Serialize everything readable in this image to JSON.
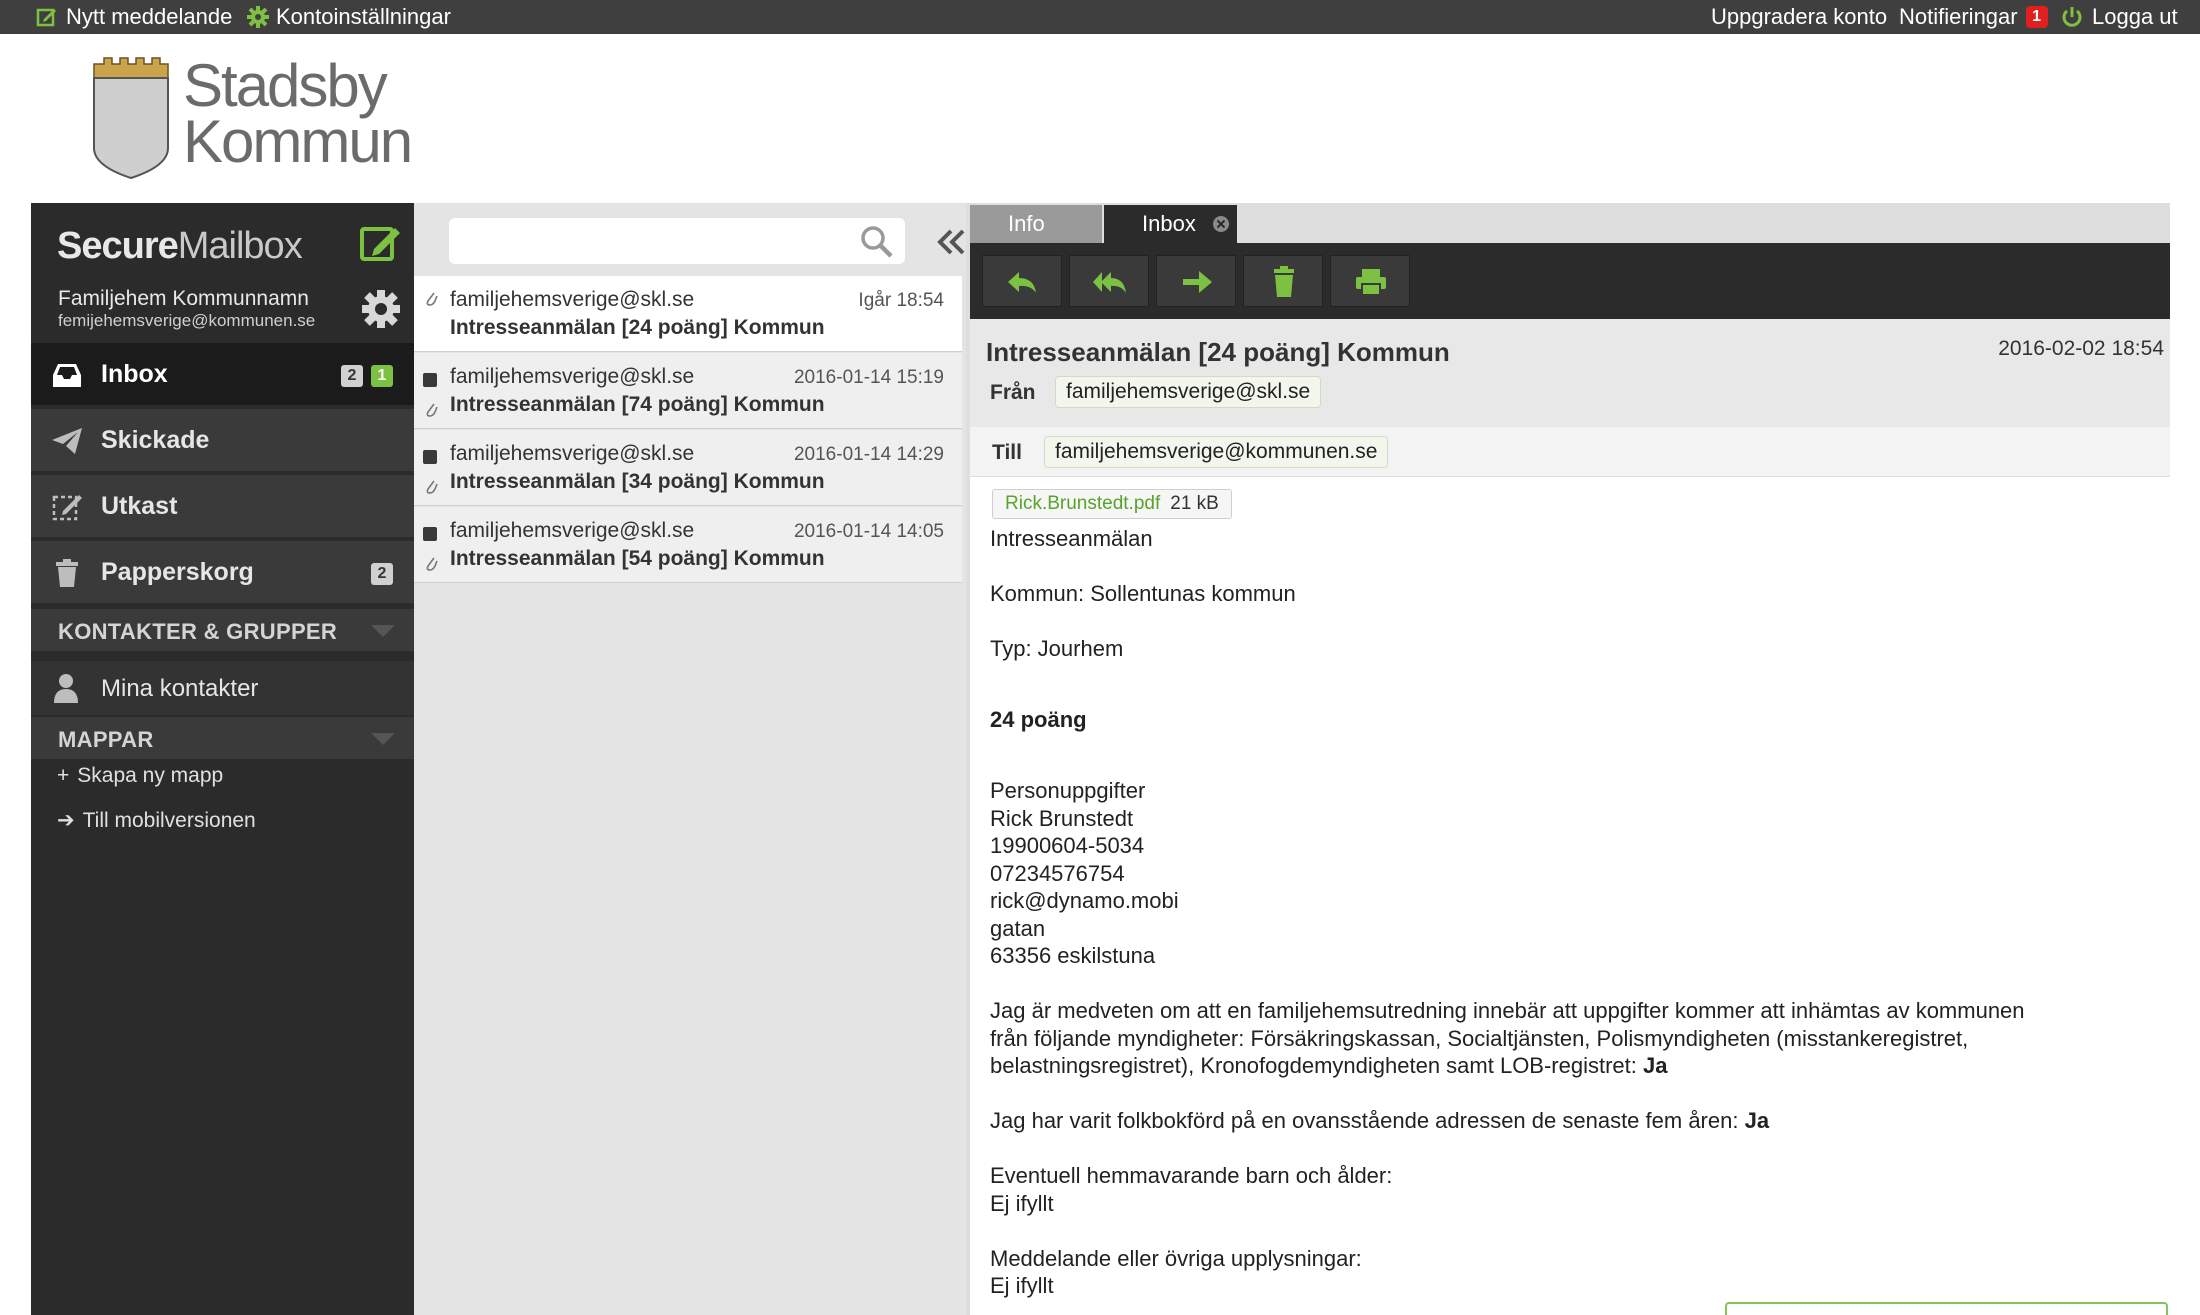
{
  "topbar": {
    "new_message": "Nytt meddelande",
    "account_settings": "Kontoinställningar",
    "upgrade": "Uppgradera konto",
    "notifications": "Notifieringar",
    "notifications_count": "1",
    "logout": "Logga ut"
  },
  "logo": {
    "line1": "Stadsby",
    "line2": "Kommun"
  },
  "brand": {
    "part1": "Secure",
    "part2": "Mailbox"
  },
  "user": {
    "name": "Familjehem Kommunnamn",
    "email": "femijehemsverige@kommunen.se"
  },
  "nav": [
    {
      "label": "Inbox",
      "icon": "inbox-icon",
      "count_total": "2",
      "count_unread": "1"
    },
    {
      "label": "Skickade",
      "icon": "send-icon"
    },
    {
      "label": "Utkast",
      "icon": "draft-icon"
    },
    {
      "label": "Papperskorg",
      "icon": "trash-icon",
      "count_total": "2"
    }
  ],
  "contacts_section": {
    "title": "KONTAKTER & GRUPPER",
    "item": "Mina kontakter"
  },
  "folders_section": {
    "title": "MAPPAR",
    "create": "Skapa ny mapp",
    "mobile": "Till mobilversionen"
  },
  "search": {
    "placeholder": ""
  },
  "messages": [
    {
      "from": "familjehemsverige@skl.se",
      "date": "Igår 18:54",
      "subject": "Intresseanmälan [24 poäng] Kommun",
      "selected": true
    },
    {
      "from": "familjehemsverige@skl.se",
      "date": "2016-01-14 15:19",
      "subject": "Intresseanmälan [74 poäng] Kommun"
    },
    {
      "from": "familjehemsverige@skl.se",
      "date": "2016-01-14 14:29",
      "subject": "Intresseanmälan [34 poäng] Kommun"
    },
    {
      "from": "familjehemsverige@skl.se",
      "date": "2016-01-14 14:05",
      "subject": "Intresseanmälan [54 poäng] Kommun"
    }
  ],
  "tabs": {
    "info": "Info",
    "inbox": "Inbox"
  },
  "mail": {
    "subject": "Intresseanmälan [24 poäng] Kommun",
    "date": "2016-02-02 18:54",
    "from_label": "Från",
    "from": "familjehemsverige@skl.se",
    "to_label": "Till",
    "to": "familjehemsverige@kommunen.se",
    "attachment_name": "Rick.Brunstedt.pdf",
    "attachment_size": "21 kB",
    "body": {
      "l1": "Intresseanmälan",
      "l2": "Kommun: Sollentunas kommun",
      "l3": "Typ: Jourhem",
      "l4": "24 poäng",
      "l5": "Personuppgifter",
      "l6": "Rick Brunstedt",
      "l7": "19900604-5034",
      "l8": "07234576754",
      "l9": "rick@dynamo.mobi",
      "l10": "gatan",
      "l11": "63356 eskilstuna",
      "l12": "Jag är medveten om att en familjehemsutredning innebär att uppgifter kommer att inhämtas av kommunen",
      "l13": "från följande myndigheter: Försäkringskassan, Socialtjänsten, Polismyndigheten (misstankeregistret,",
      "l14a": "belastningsregistret), Kronofogdemyndigheten samt LOB-registret: ",
      "l14b": "Ja",
      "l15a": "Jag har varit folkbokförd på en ovansstående adressen de senaste fem åren: ",
      "l15b": "Ja",
      "l16": "Eventuell hemmavarande barn och ålder:",
      "l17": "Ej ifyllt",
      "l18": "Meddelande eller övriga upplysningar:",
      "l19": "Ej ifyllt"
    }
  },
  "colors": {
    "accent_green": "#7cc142",
    "sidebar_bg": "#2b2b2b",
    "badge_red": "#e02020"
  }
}
